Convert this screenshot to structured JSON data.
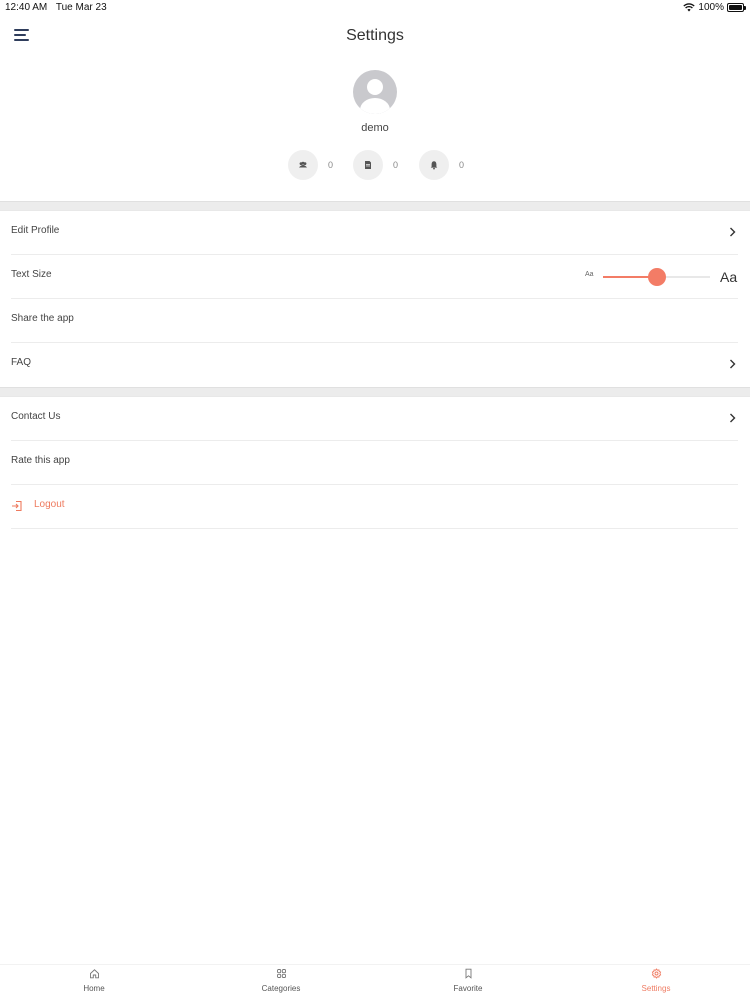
{
  "status_bar": {
    "time": "12:40 AM",
    "date": "Tue Mar 23",
    "battery": "100%"
  },
  "header": {
    "title": "Settings"
  },
  "profile": {
    "username": "demo"
  },
  "stats": [
    {
      "icon": "users-icon",
      "count": "0"
    },
    {
      "icon": "document-icon",
      "count": "0"
    },
    {
      "icon": "bell-icon",
      "count": "0"
    }
  ],
  "menu": {
    "edit_profile": "Edit Profile",
    "text_size": "Text Size",
    "share_app": "Share the app",
    "faq": "FAQ",
    "contact_us": "Contact Us",
    "rate_app": "Rate this app",
    "logout": "Logout"
  },
  "text_size_slider": {
    "small_label": "Aa",
    "large_label": "Aa",
    "value": 0.5
  },
  "tabs": [
    {
      "label": "Home",
      "icon": "home-icon",
      "active": false
    },
    {
      "label": "Categories",
      "icon": "grid-icon",
      "active": false
    },
    {
      "label": "Favorite",
      "icon": "bookmark-icon",
      "active": false
    },
    {
      "label": "Settings",
      "icon": "gear-icon",
      "active": true
    }
  ],
  "colors": {
    "accent": "#F37C66",
    "menu_icon": "#2F3D5C",
    "divider": "#ECECEC"
  }
}
